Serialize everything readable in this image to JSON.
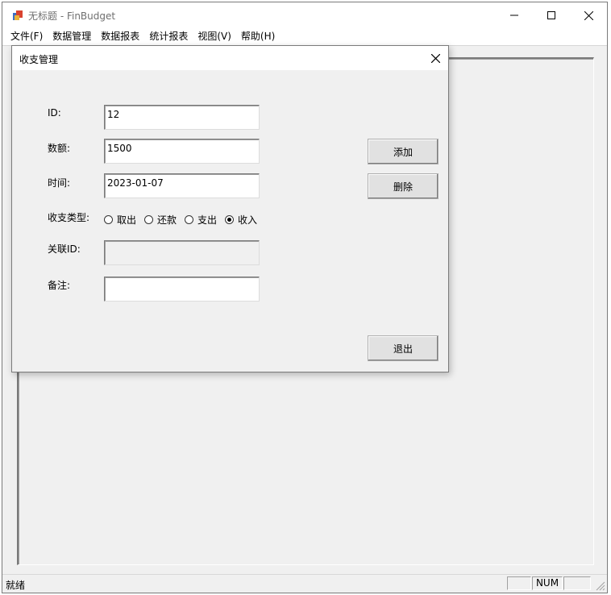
{
  "window": {
    "title": "无标题 - FinBudget",
    "icon": "app-icon",
    "controls": [
      "minimize-icon",
      "maximize-icon",
      "close-icon"
    ]
  },
  "menubar": {
    "items": [
      "文件(F)",
      "数据管理",
      "数据报表",
      "统计报表",
      "视图(V)",
      "帮助(H)"
    ]
  },
  "dialog": {
    "title": "收支管理",
    "fields": {
      "id": {
        "label": "ID:",
        "value": "12"
      },
      "amount": {
        "label": "数额:",
        "value": "1500"
      },
      "time": {
        "label": "时间:",
        "value": "2023-01-07"
      },
      "related_id": {
        "label": "关联ID:",
        "value": ""
      },
      "note": {
        "label": "备注:",
        "value": ""
      }
    },
    "type": {
      "label": "收支类型:",
      "options": [
        "取出",
        "还款",
        "支出",
        "收入"
      ],
      "selected": "收入"
    },
    "buttons": {
      "add": "添加",
      "delete": "删除",
      "exit": "退出"
    }
  },
  "statusbar": {
    "text": "就绪",
    "panes": [
      "",
      "NUM",
      ""
    ]
  }
}
